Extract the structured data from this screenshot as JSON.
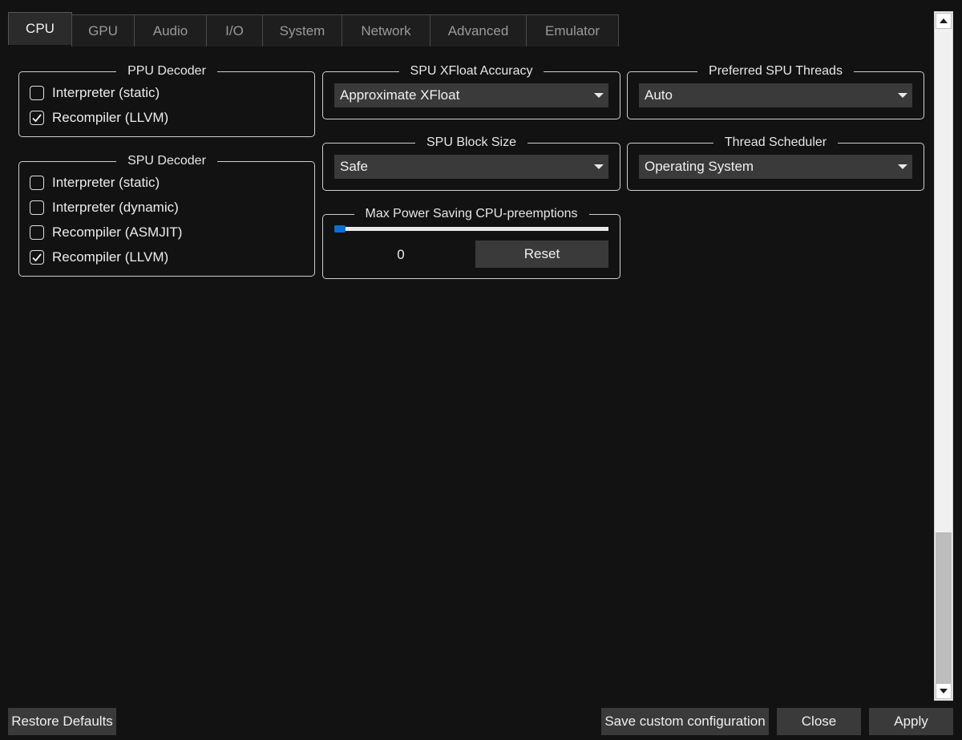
{
  "tabs": [
    {
      "label": "CPU",
      "active": true
    },
    {
      "label": "GPU"
    },
    {
      "label": "Audio"
    },
    {
      "label": "I/O"
    },
    {
      "label": "System"
    },
    {
      "label": "Network"
    },
    {
      "label": "Advanced"
    },
    {
      "label": "Emulator"
    }
  ],
  "ppu_decoder": {
    "title": "PPU Decoder",
    "options": [
      {
        "label": "Interpreter (static)",
        "checked": false
      },
      {
        "label": "Recompiler (LLVM)",
        "checked": true
      }
    ]
  },
  "spu_decoder": {
    "title": "SPU Decoder",
    "options": [
      {
        "label": "Interpreter (static)",
        "checked": false
      },
      {
        "label": "Interpreter (dynamic)",
        "checked": false
      },
      {
        "label": "Recompiler (ASMJIT)",
        "checked": false
      },
      {
        "label": "Recompiler (LLVM)",
        "checked": true
      }
    ]
  },
  "spu_xfloat": {
    "title": "SPU XFloat Accuracy",
    "value": "Approximate XFloat"
  },
  "spu_block_size": {
    "title": "SPU Block Size",
    "value": "Safe"
  },
  "preferred_spu_threads": {
    "title": "Preferred SPU Threads",
    "value": "Auto"
  },
  "thread_scheduler": {
    "title": "Thread Scheduler",
    "value": "Operating System"
  },
  "max_power_saving": {
    "title": "Max Power Saving CPU-preemptions",
    "value": "0",
    "slider_fraction": 0.0,
    "reset_label": "Reset"
  },
  "scrollbar": {
    "thumb_start_fraction": 0.77,
    "thumb_end_fraction": 1.0
  },
  "footer": {
    "restore_defaults": "Restore Defaults",
    "save_custom": "Save custom configuration",
    "close": "Close",
    "apply": "Apply"
  },
  "colors": {
    "accent": "#0a6fd4",
    "background": "#121212",
    "control": "#3a3a3a"
  }
}
